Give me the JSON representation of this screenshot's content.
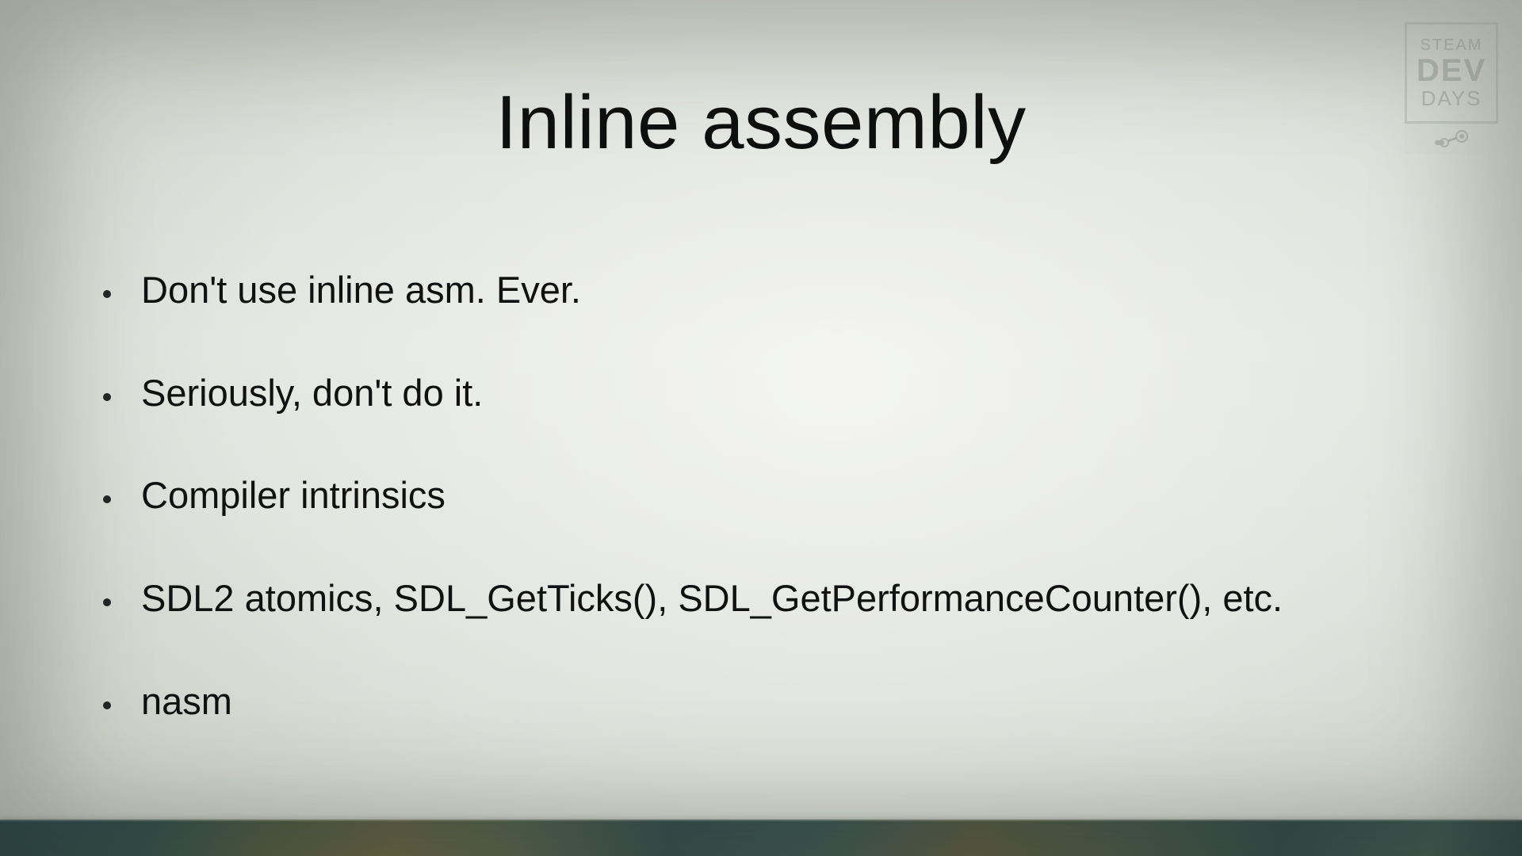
{
  "slide": {
    "title": "Inline assembly",
    "bullets": [
      "Don't use inline asm. Ever.",
      "Seriously, don't do it.",
      "Compiler intrinsics",
      "SDL2 atomics, SDL_GetTicks(), SDL_GetPerformanceCounter(), etc.",
      "nasm"
    ]
  },
  "logo": {
    "line1": "STEAM",
    "line2": "DEV",
    "line3": "DAYS"
  }
}
